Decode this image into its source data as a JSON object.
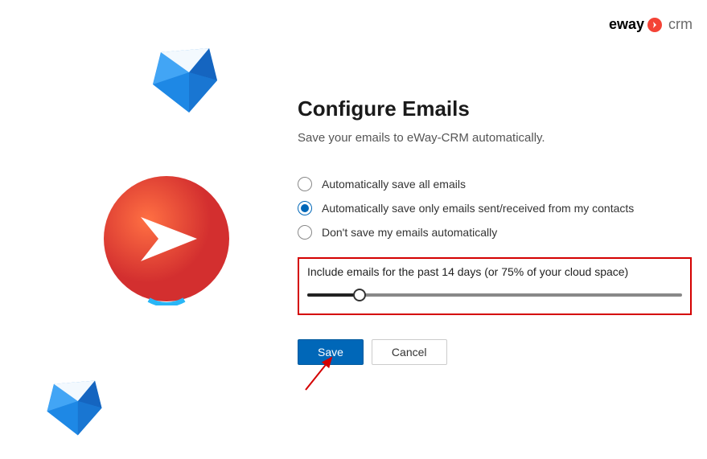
{
  "brand": {
    "part1": "eway",
    "part2": "crm"
  },
  "title": "Configure Emails",
  "subtitle": "Save your emails to eWay-CRM automatically.",
  "options": [
    {
      "label": "Automatically save all emails",
      "selected": false
    },
    {
      "label": "Automatically save only emails sent/received from my contacts",
      "selected": true
    },
    {
      "label": "Don't save my emails automatically",
      "selected": false
    }
  ],
  "slider": {
    "label": "Include emails for the past 14 days (or 75% of your cloud space)",
    "percent": 14
  },
  "buttons": {
    "save": "Save",
    "cancel": "Cancel"
  },
  "colors": {
    "accent": "#0067b8",
    "highlight": "#d40000",
    "brand_red": "#f44336"
  }
}
